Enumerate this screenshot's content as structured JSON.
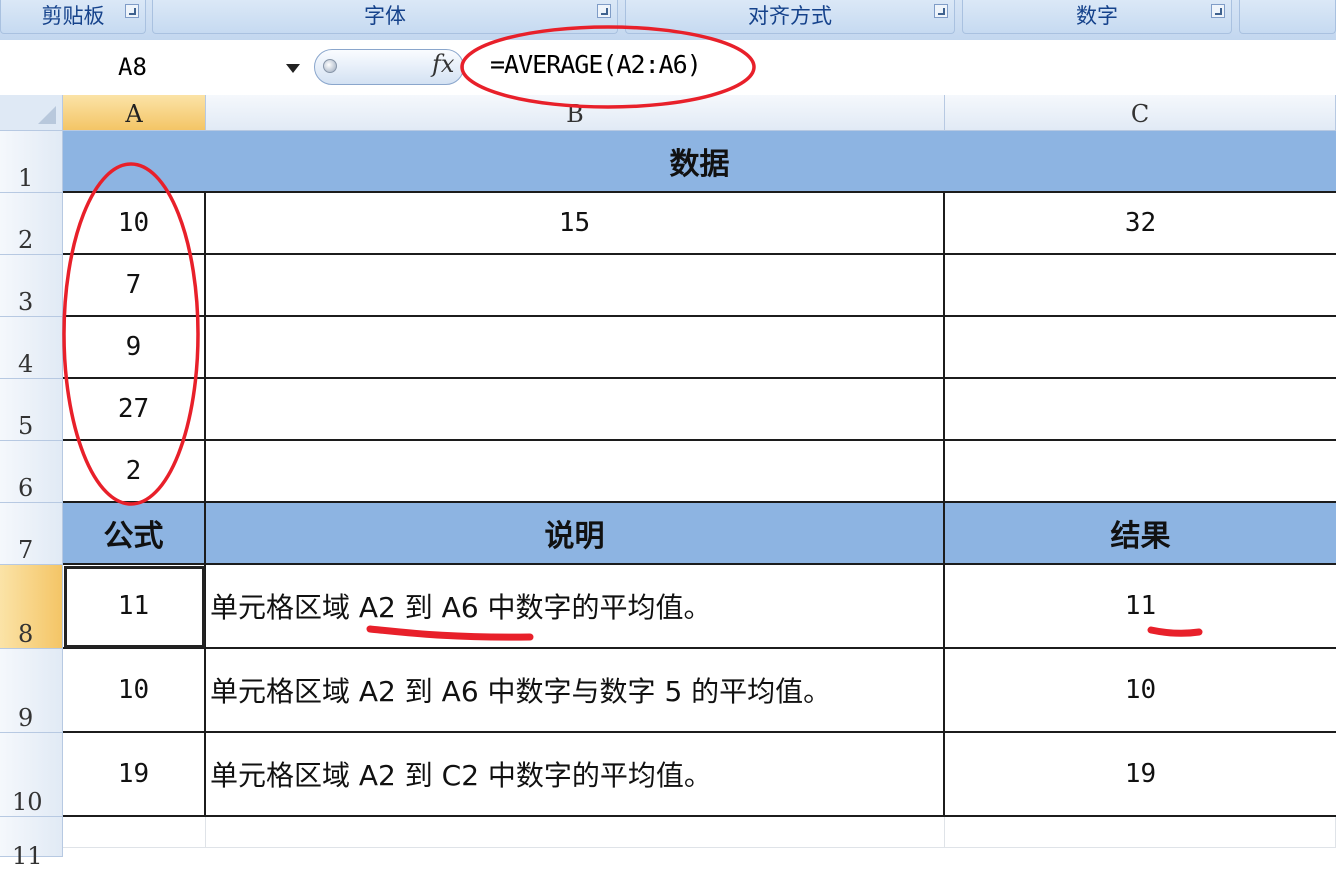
{
  "ribbon": {
    "groups": [
      {
        "label": "剪贴板"
      },
      {
        "label": "字体"
      },
      {
        "label": "对齐方式"
      },
      {
        "label": "数字"
      }
    ]
  },
  "formula_bar": {
    "name_box": "A8",
    "formula": "=AVERAGE(A2:A6)",
    "fx_label": "fx"
  },
  "columns": [
    "A",
    "B",
    "C"
  ],
  "rows": [
    "1",
    "2",
    "3",
    "4",
    "5",
    "6",
    "7",
    "8",
    "9",
    "10",
    "11"
  ],
  "sheet": {
    "title": "数据",
    "data_rows": [
      [
        "10",
        "15",
        "32"
      ],
      [
        "7",
        "",
        ""
      ],
      [
        "9",
        "",
        ""
      ],
      [
        "27",
        "",
        ""
      ],
      [
        "2",
        "",
        ""
      ]
    ],
    "headers": [
      "公式",
      "说明",
      "结果"
    ],
    "results": [
      {
        "formula_value": "11",
        "description": "单元格区域 A2 到 A6 中数字的平均值。",
        "result": "11"
      },
      {
        "formula_value": "10",
        "description": "单元格区域 A2 到 A6 中数字与数字 5 的平均值。",
        "result": "10"
      },
      {
        "formula_value": "19",
        "description": "单元格区域 A2 到 C2 中数字的平均值。",
        "result": "19"
      }
    ]
  },
  "colors": {
    "header_fill": "#8db4e2",
    "selected_header": "#f4c566",
    "annotation_red": "#e8202a"
  }
}
